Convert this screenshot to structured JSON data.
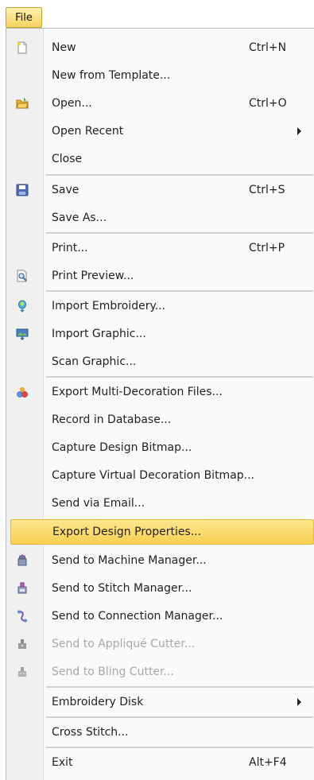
{
  "menu_title": "File",
  "items": [
    {
      "label": "New",
      "shortcut": "Ctrl+N",
      "icon": "new-document-icon"
    },
    {
      "label": "New from Template...",
      "shortcut": "",
      "icon": ""
    },
    {
      "label": "Open...",
      "shortcut": "Ctrl+O",
      "icon": "open-folder-icon"
    },
    {
      "label": "Open Recent",
      "shortcut": "",
      "icon": "",
      "submenu": true
    },
    {
      "label": "Close",
      "shortcut": "",
      "icon": ""
    },
    {
      "label": "Save",
      "shortcut": "Ctrl+S",
      "icon": "save-disk-icon"
    },
    {
      "label": "Save As...",
      "shortcut": "",
      "icon": ""
    },
    {
      "label": "Print...",
      "shortcut": "Ctrl+P",
      "icon": ""
    },
    {
      "label": "Print Preview...",
      "shortcut": "",
      "icon": "print-preview-icon"
    },
    {
      "label": "Import Embroidery...",
      "shortcut": "",
      "icon": "import-embroidery-icon"
    },
    {
      "label": "Import Graphic...",
      "shortcut": "",
      "icon": "import-graphic-icon"
    },
    {
      "label": "Scan Graphic...",
      "shortcut": "",
      "icon": ""
    },
    {
      "label": "Export Multi-Decoration Files...",
      "shortcut": "",
      "icon": "export-multi-decoration-icon"
    },
    {
      "label": "Record in Database...",
      "shortcut": "",
      "icon": ""
    },
    {
      "label": "Capture Design Bitmap...",
      "shortcut": "",
      "icon": ""
    },
    {
      "label": "Capture Virtual Decoration Bitmap...",
      "shortcut": "",
      "icon": ""
    },
    {
      "label": "Send via Email...",
      "shortcut": "",
      "icon": ""
    },
    {
      "label": "Export Design Properties...",
      "shortcut": "",
      "icon": "",
      "highlighted": true
    },
    {
      "label": "Send to Machine Manager...",
      "shortcut": "",
      "icon": "machine-manager-icon"
    },
    {
      "label": "Send to Stitch Manager...",
      "shortcut": "",
      "icon": "stitch-manager-icon"
    },
    {
      "label": "Send to Connection Manager...",
      "shortcut": "",
      "icon": "connection-manager-icon"
    },
    {
      "label": "Send to Appliqué Cutter...",
      "shortcut": "",
      "icon": "applique-cutter-icon",
      "disabled": true
    },
    {
      "label": "Send to Bling Cutter...",
      "shortcut": "",
      "icon": "bling-cutter-icon",
      "disabled": true
    },
    {
      "label": "Embroidery Disk",
      "shortcut": "",
      "icon": "",
      "submenu": true
    },
    {
      "label": "Cross Stitch...",
      "shortcut": "",
      "icon": ""
    },
    {
      "label": "Exit",
      "shortcut": "Alt+F4",
      "icon": ""
    }
  ],
  "colors": {
    "highlight": "#f7cf52",
    "highlight_border": "#e6b93a",
    "disabled_text": "#a8a8a8"
  }
}
